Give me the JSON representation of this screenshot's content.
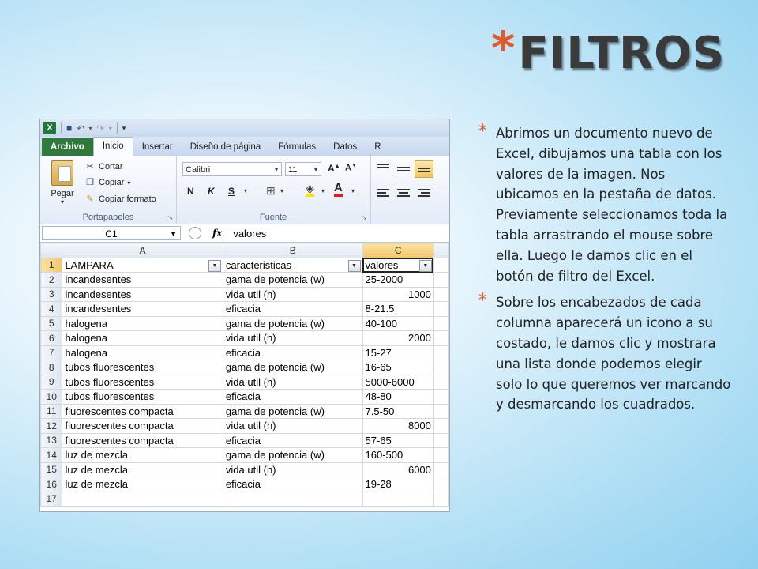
{
  "slide": {
    "title": "FILTROS",
    "bullets": [
      "Abrimos un documento nuevo de Excel, dibujamos una tabla con los valores de la imagen. Nos ubicamos en la pestaña de datos. Previamente seleccionamos toda la tabla arrastrando el mouse sobre ella. Luego le damos clic en el botón de filtro del Excel.",
      "Sobre los encabezados de cada columna aparecerá un icono a su costado, le damos clic y mostrara una lista donde podemos elegir solo lo que queremos ver marcando y desmarcando los cuadrados."
    ]
  },
  "excel": {
    "logo": "X",
    "tabs": [
      "Archivo",
      "Inicio",
      "Insertar",
      "Diseño de página",
      "Fórmulas",
      "Datos",
      "R"
    ],
    "clipboard": {
      "paste": "Pegar",
      "cut": "Cortar",
      "copy": "Copiar",
      "format": "Copiar formato",
      "label": "Portapapeles"
    },
    "font": {
      "name": "Calibri",
      "size": "11",
      "bold": "N",
      "italic": "K",
      "underline": "S",
      "label": "Fuente"
    },
    "namebox": "C1",
    "fx": "fx",
    "formula": "valores",
    "columns": [
      "A",
      "B",
      "C"
    ],
    "rows": [
      {
        "n": "1",
        "a": "LAMPARA",
        "b": "caracteristicas",
        "c": "valores"
      },
      {
        "n": "2",
        "a": "incandesentes",
        "b": "gama de potencia (w)",
        "c": "25-2000"
      },
      {
        "n": "3",
        "a": "incandesentes",
        "b": "vida util (h)",
        "c": "1000"
      },
      {
        "n": "4",
        "a": "incandesentes",
        "b": "eficacia",
        "c": "8-21.5"
      },
      {
        "n": "5",
        "a": "halogena",
        "b": "gama de potencia (w)",
        "c": "40-100"
      },
      {
        "n": "6",
        "a": "halogena",
        "b": "vida util (h)",
        "c": "2000"
      },
      {
        "n": "7",
        "a": "halogena",
        "b": "eficacia",
        "c": "15-27"
      },
      {
        "n": "8",
        "a": "tubos fluorescentes",
        "b": "gama de potencia (w)",
        "c": "16-65"
      },
      {
        "n": "9",
        "a": "tubos fluorescentes",
        "b": "vida util (h)",
        "c": "5000-6000"
      },
      {
        "n": "10",
        "a": "tubos fluorescentes",
        "b": "eficacia",
        "c": "48-80"
      },
      {
        "n": "11",
        "a": "fluorescentes compacta",
        "b": "gama de potencia (w)",
        "c": "7.5-50"
      },
      {
        "n": "12",
        "a": "fluorescentes compacta",
        "b": "vida util (h)",
        "c": "8000"
      },
      {
        "n": "13",
        "a": "fluorescentes compacta",
        "b": "eficacia",
        "c": "57-65"
      },
      {
        "n": "14",
        "a": "luz de mezcla",
        "b": "gama de potencia (w)",
        "c": "160-500"
      },
      {
        "n": "15",
        "a": "luz de mezcla",
        "b": "vida util (h)",
        "c": "6000"
      },
      {
        "n": "16",
        "a": "luz de mezcla",
        "b": "eficacia",
        "c": "19-28"
      },
      {
        "n": "17",
        "a": "",
        "b": "",
        "c": ""
      }
    ],
    "numeric_rows": [
      "3",
      "6",
      "12",
      "15"
    ]
  }
}
